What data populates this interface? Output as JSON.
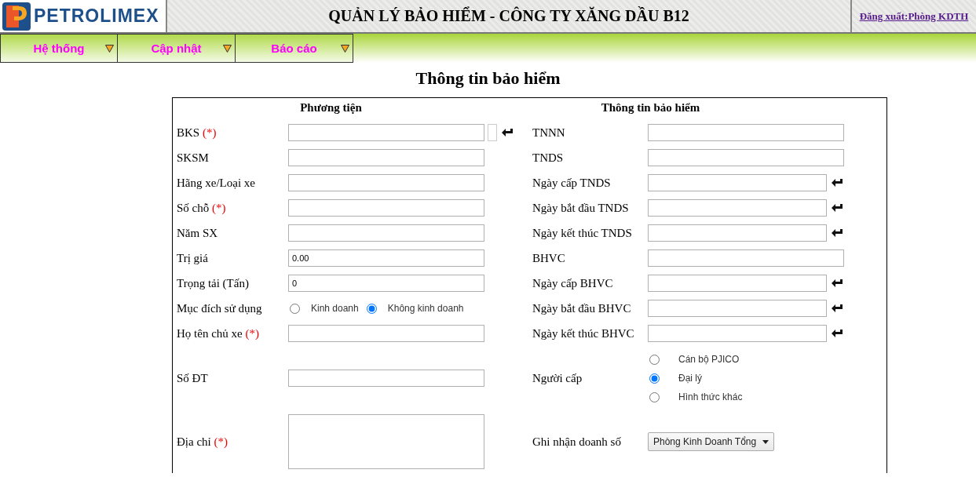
{
  "header": {
    "logo_text": "PETROLIMEX",
    "title": "QUẢN LÝ BẢO HIỂM - CÔNG TY XĂNG DẦU B12",
    "logout_link": "Đăng xuất:Phòng KDTH"
  },
  "menu": [
    {
      "label": "Hệ thống"
    },
    {
      "label": "Cập nhật"
    },
    {
      "label": "Báo cáo"
    }
  ],
  "page_title": "Thông tin bảo hiểm",
  "form": {
    "left_heading": "Phương tiện",
    "right_heading": "Thông tin bảo hiểm",
    "rows": [
      {
        "left": {
          "kind": "lookup",
          "label": "BKS",
          "required_mark": "(*)"
        },
        "right": {
          "kind": "text",
          "label": "TNNN"
        }
      },
      {
        "left": {
          "kind": "text",
          "label": "SKSM"
        },
        "right": {
          "kind": "text",
          "label": "TNDS"
        }
      },
      {
        "left": {
          "kind": "text",
          "label": "Hãng xe/Loại xe"
        },
        "right": {
          "kind": "date",
          "label": "Ngày cấp TNDS"
        }
      },
      {
        "left": {
          "kind": "text",
          "label": "Số chỗ",
          "required_mark": "(*)"
        },
        "right": {
          "kind": "date",
          "label": "Ngày bắt đầu TNDS"
        }
      },
      {
        "left": {
          "kind": "text",
          "label": "Năm SX"
        },
        "right": {
          "kind": "date",
          "label": "Ngày kết thúc TNDS"
        }
      },
      {
        "left": {
          "kind": "text",
          "label": "Trị giá",
          "value": "0.00"
        },
        "right": {
          "kind": "text",
          "label": "BHVC"
        }
      },
      {
        "left": {
          "kind": "text",
          "label": "Trọng tải (Tấn)",
          "value": "0"
        },
        "right": {
          "kind": "date",
          "label": "Ngày cấp BHVC"
        }
      },
      {
        "left": {
          "kind": "radio_inline",
          "label": "Mục đích sử dụng",
          "options": [
            {
              "label": "Kinh doanh",
              "selected": false
            },
            {
              "label": "Không kinh doanh",
              "selected": true
            }
          ]
        },
        "right": {
          "kind": "date",
          "label": "Ngày bắt đầu BHVC"
        }
      },
      {
        "left": {
          "kind": "text",
          "label": "Họ tên chủ xe",
          "required_mark": "(*)"
        },
        "right": {
          "kind": "date",
          "label": "Ngày kết thúc BHVC"
        }
      },
      {
        "left": {
          "kind": "text",
          "label": "Số ĐT"
        },
        "right": {
          "kind": "radio_stack",
          "label": "Người cấp",
          "options": [
            {
              "label": "Cán bộ PJICO",
              "selected": false
            },
            {
              "label": "Đại lý",
              "selected": true
            },
            {
              "label": "Hình thức khác",
              "selected": false
            }
          ]
        }
      },
      {
        "left": {
          "kind": "textarea",
          "label": "Địa chỉ",
          "required_mark": "(*)"
        },
        "right": {
          "kind": "select",
          "label": "Ghi nhận doanh số",
          "value": "Phòng Kinh Doanh Tổng"
        }
      }
    ]
  }
}
